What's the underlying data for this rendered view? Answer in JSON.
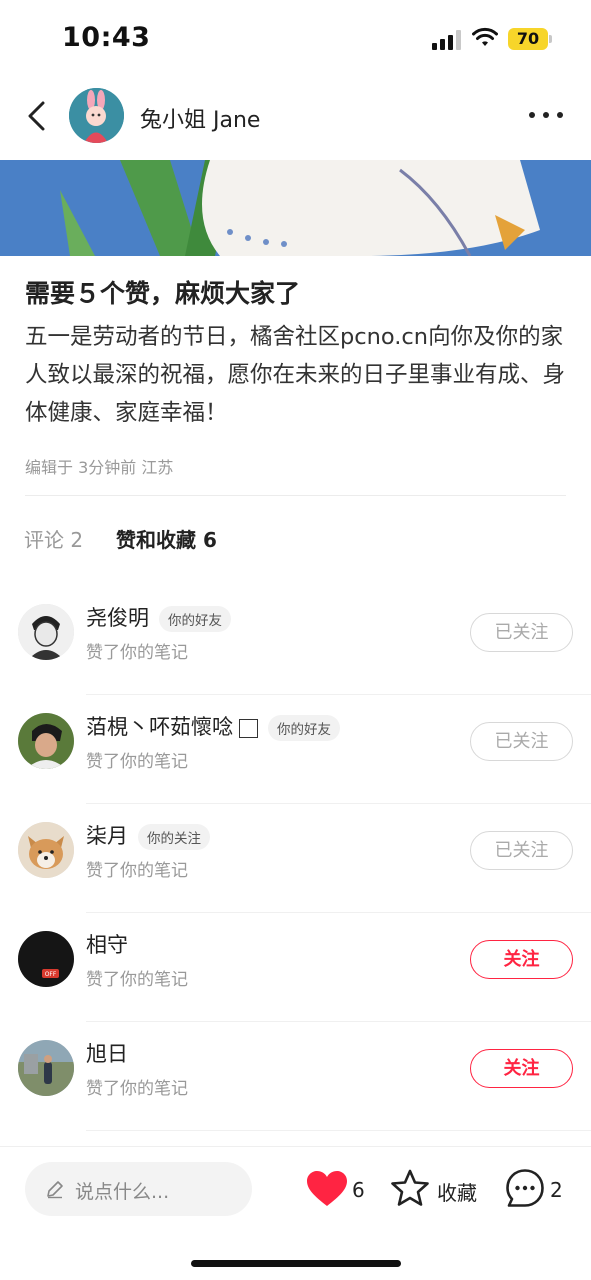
{
  "status_bar": {
    "time": "10:43",
    "battery": "70"
  },
  "header": {
    "author": "兔小姐 Jane"
  },
  "post": {
    "title": "需要５个赞，麻烦大家了",
    "body": "五一是劳动者的节日，橘舍社区pcno.cn向你及你的家人致以最深的祝福，愿你在未来的日子里事业有成、身体健康、家庭幸福！",
    "meta": "编辑于 3分钟前 江苏"
  },
  "tabs": {
    "comments": "评论 2",
    "likes": "赞和收藏 6"
  },
  "likers": [
    {
      "name": "尧俊明",
      "badge": "你的好友",
      "action": "赞了你的笔记",
      "button": "已关注",
      "followed": true
    },
    {
      "name": "萡梘丶吥茹懷唸",
      "badge": "你的好友",
      "action": "赞了你的笔记",
      "button": "已关注",
      "followed": true
    },
    {
      "name": "柒月",
      "badge": "你的关注",
      "action": "赞了你的笔记",
      "button": "已关注",
      "followed": true
    },
    {
      "name": "相守",
      "badge": "",
      "action": "赞了你的笔记",
      "button": "关注",
      "followed": false
    },
    {
      "name": "旭日",
      "badge": "",
      "action": "赞了你的笔记",
      "button": "关注",
      "followed": false
    }
  ],
  "bottom_bar": {
    "placeholder": "说点什么...",
    "like_count": "6",
    "favorite_label": "收藏",
    "comment_count": "2"
  },
  "colors": {
    "accent": "#ff2442",
    "battery": "#f7d52a"
  },
  "icons": [
    "back-icon",
    "more-icon",
    "pencil-icon",
    "heart-icon",
    "star-icon",
    "comment-bubble-icon"
  ]
}
